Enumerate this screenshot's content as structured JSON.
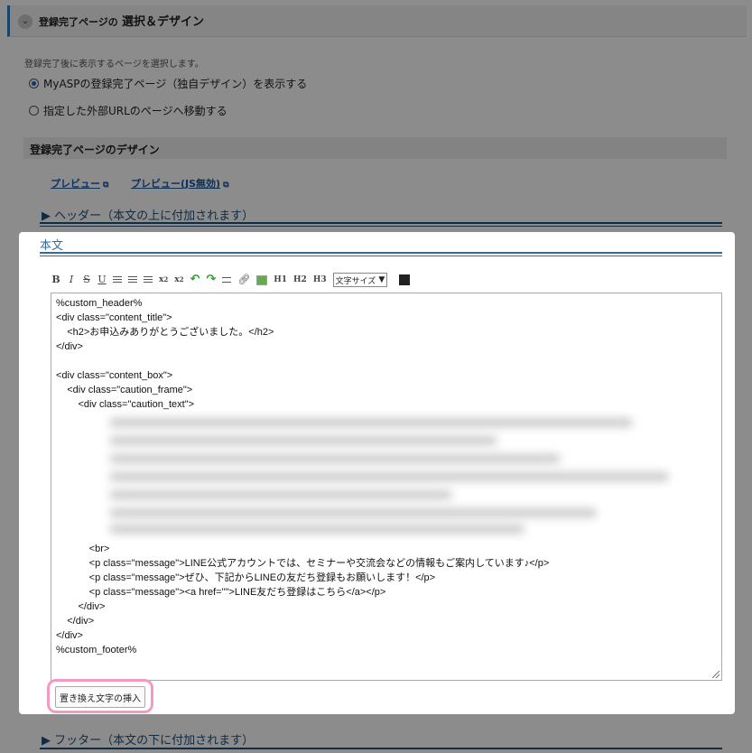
{
  "section": {
    "small_title": "登録完了ページの",
    "big_title": "選択＆デザイン",
    "description": "登録完了後に表示するページを選択します。",
    "options": [
      {
        "label": "MyASPの登録完了ページ（独自デザイン）を表示する",
        "selected": true
      },
      {
        "label": "指定した外部URLのページへ移動する",
        "selected": false
      }
    ]
  },
  "design": {
    "title": "登録完了ページのデザイン",
    "preview_label": "プレビュー",
    "preview_nojs_label": "プレビュー(JS無効)"
  },
  "header_accordion": "▶ ヘッダー（本文の上に付加されます）",
  "body_tab": "本文",
  "toolbar": {
    "bold": "B",
    "italic": "I",
    "strike": "S",
    "underline": "U",
    "sub_x": "x",
    "sub_2": "2",
    "sup_x": "x",
    "sup_2": "2",
    "h1": "H1",
    "h2": "H2",
    "h3": "H3",
    "font_size": "文字サイズ"
  },
  "code_lines": [
    "%custom_header%",
    "<div class=\"content_title\">",
    "    <h2>お申込みありがとうございました。</h2>",
    "</div>",
    "",
    "<div class=\"content_box\">",
    "    <div class=\"caution_frame\">",
    "        <div class=\"caution_text\">",
    "            <br>",
    "            <p class=\"message\">LINE公式アカウントでは、セミナーや交流会などの情報もご案内しています♪</p>",
    "            <p class=\"message\">ぜひ、下記からLINEの友だち登録もお願いします！</p>",
    "            <p class=\"message\"><a href=\"\">LINE友だち登録はこちら</a></p>",
    "        </div>",
    "    </div>",
    "</div>",
    "%custom_footer%"
  ],
  "insert_button": "置き換え文字の挿入",
  "footer_accordion": "▶ フッター（本文の下に付加されます）",
  "colors": {
    "accent": "#2c7fb8",
    "link": "#1a5aa8",
    "highlight": "#f49ac1"
  }
}
